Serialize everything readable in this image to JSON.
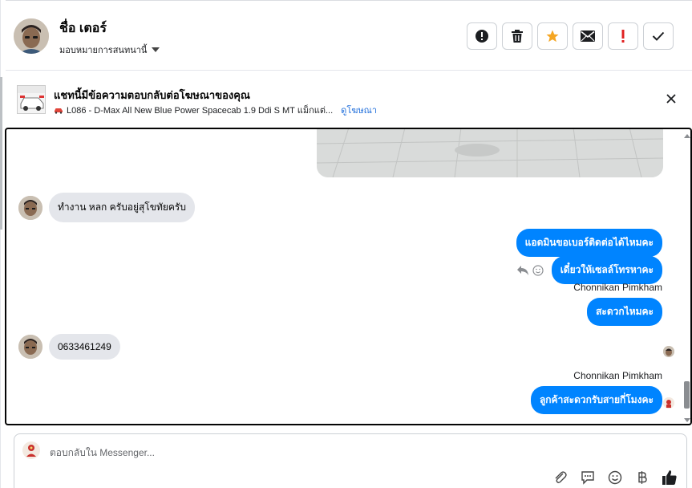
{
  "header": {
    "contact_name": "ชื่อ เตอร์",
    "assign_label": "มอบหมายการสนทนานี้",
    "actions": [
      {
        "icon": "alert-circle-icon",
        "label": "mark-spam"
      },
      {
        "icon": "trash-icon",
        "label": "delete"
      },
      {
        "icon": "star-icon",
        "label": "star",
        "color": "#f5a623"
      },
      {
        "icon": "envelope-icon",
        "label": "mark-unread"
      },
      {
        "icon": "exclamation-icon",
        "label": "follow-up",
        "color": "#e02020"
      },
      {
        "icon": "check-icon",
        "label": "mark-done"
      }
    ]
  },
  "ad": {
    "title": "แชทนี้มีข้อความตอบกลับต่อโฆษณาของคุณ",
    "product": "L086 - D-Max All New Blue Power Spacecab 1.9 Ddi S MT แม็กแต่...",
    "link_label": "ดูโฆษณา"
  },
  "chat": {
    "messages": [
      {
        "direction": "in",
        "text": "ทำงาน หลก ครับอยู่สุโขทัยครับ"
      },
      {
        "direction": "out",
        "text": "แอดมินขอเบอร์ติดต่อได้ไหมคะ"
      },
      {
        "direction": "out",
        "text": "เดี๋ยวให้เซลล์โทรหาคะ"
      },
      {
        "direction": "out",
        "sender": "Chonnikan Pimkham",
        "text": "สะดวกไหมคะ"
      },
      {
        "direction": "in",
        "text": "0633461249"
      },
      {
        "direction": "out",
        "sender": "Chonnikan Pimkham",
        "text": "ลูกค้าสะดวกรับสายกี่โมงคะ"
      }
    ]
  },
  "composer": {
    "placeholder": "ตอบกลับใน Messenger...",
    "tools": [
      "attachment-icon",
      "saved-reply-icon",
      "emoji-icon",
      "baht-icon",
      "like-icon"
    ]
  },
  "colors": {
    "accent": "#0084ff",
    "link": "#216fdb",
    "incoming_bubble": "#e4e6eb"
  }
}
